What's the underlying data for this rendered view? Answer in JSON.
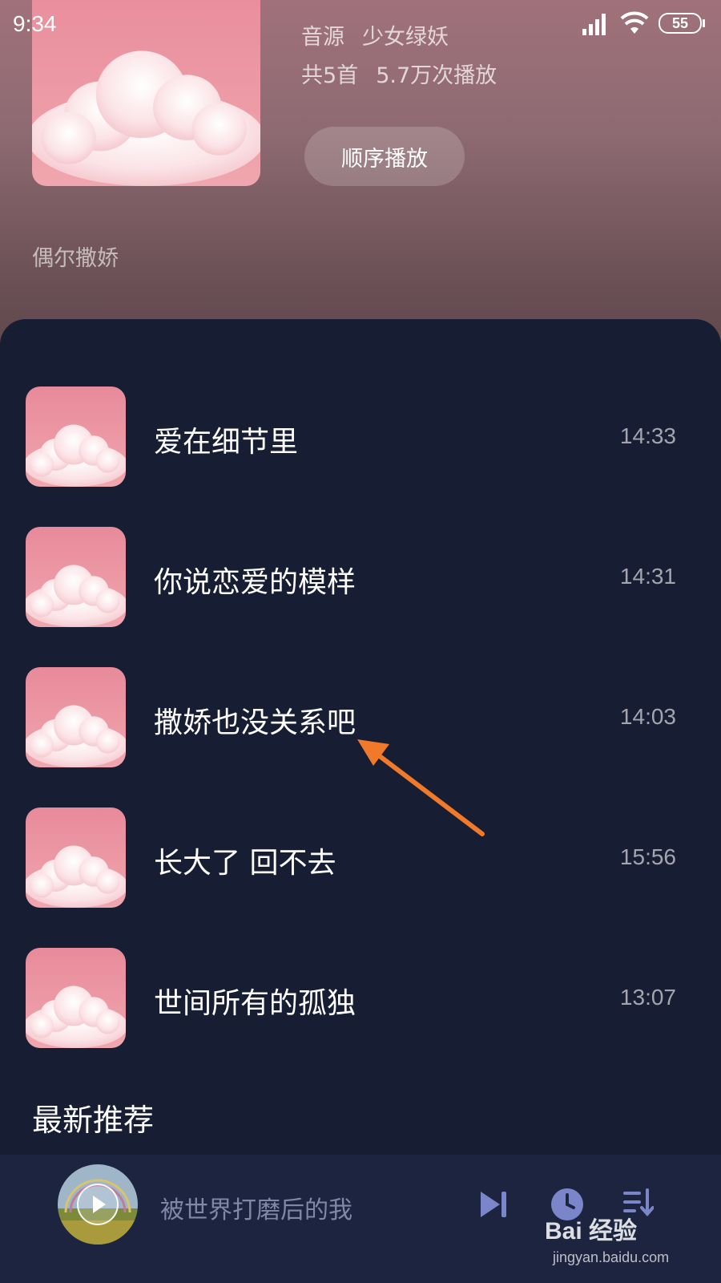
{
  "status_bar": {
    "time": "9:34",
    "battery": "55",
    "icons": [
      "signal-icon",
      "wifi-icon",
      "battery-icon"
    ]
  },
  "playlist": {
    "source_label": "音源",
    "source_name": "少女绿妖",
    "track_count": "共5首",
    "play_count": "5.7万次播放",
    "play_order_label": "顺序播放",
    "description": "偶尔撒娇"
  },
  "songs": [
    {
      "title": "爱在细节里",
      "duration": "14:33"
    },
    {
      "title": "你说恋爱的模样",
      "duration": "14:31"
    },
    {
      "title": "撒娇也没关系吧",
      "duration": "14:03"
    },
    {
      "title": "长大了 回不去",
      "duration": "15:56"
    },
    {
      "title": "世间所有的孤独",
      "duration": "13:07"
    }
  ],
  "section": {
    "recommend_title": "最新推荐"
  },
  "player": {
    "now_playing": "被世界打磨后的我",
    "icons": [
      "play-icon",
      "next-icon",
      "timer-icon",
      "playlist-icon"
    ]
  },
  "watermark": {
    "brand": "Bai 经验",
    "url": "jingyan.baidu.com"
  },
  "colors": {
    "header_bg": "#a0717b",
    "panel_bg": "#171e33",
    "player_bg": "#1c2440",
    "accent_icon": "#7a86c9",
    "arrow": "#f07a2a"
  }
}
